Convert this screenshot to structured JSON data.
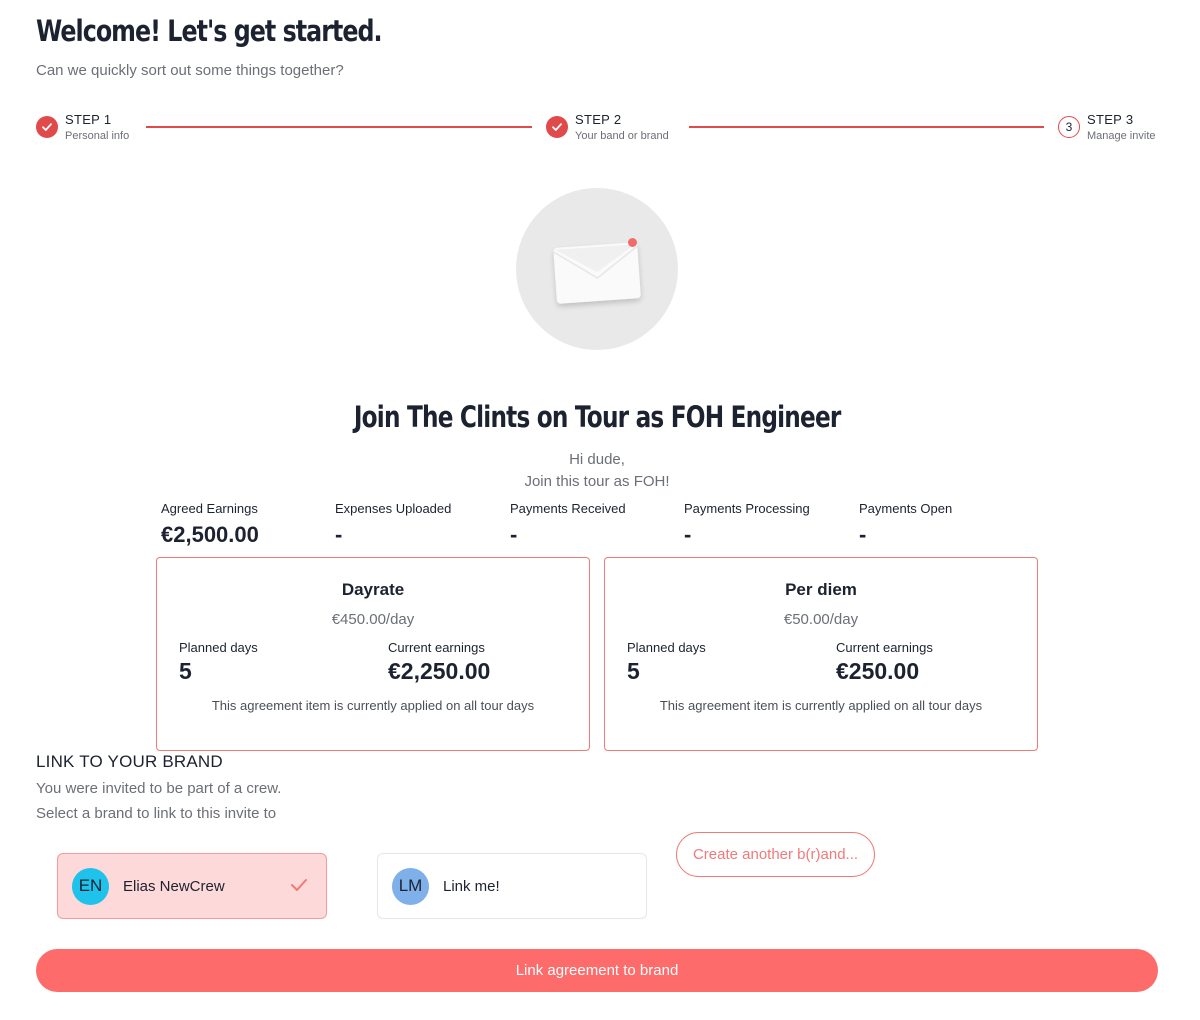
{
  "header": {
    "title": "Welcome! Let's get started.",
    "subtitle": "Can we quickly sort out some things together?"
  },
  "stepper": {
    "steps": [
      {
        "label": "STEP 1",
        "description": "Personal info",
        "status": "completed"
      },
      {
        "label": "STEP 2",
        "description": "Your band or brand",
        "status": "completed"
      },
      {
        "label": "STEP 3",
        "description": "Manage invite",
        "status": "current",
        "number": "3"
      }
    ]
  },
  "invite": {
    "icon": "envelope-icon",
    "title": "Join The Clints on Tour as FOH Engineer",
    "message_line1": "Hi dude,",
    "message_line2": "Join this tour as FOH!"
  },
  "stats": [
    {
      "label": "Agreed Earnings",
      "value": "€2,500.00"
    },
    {
      "label": "Expenses Uploaded",
      "value": "-"
    },
    {
      "label": "Payments Received",
      "value": "-"
    },
    {
      "label": "Payments Processing",
      "value": "-"
    },
    {
      "label": "Payments Open",
      "value": "-"
    }
  ],
  "agreement_items": [
    {
      "title": "Dayrate",
      "rate": "€450.00/day",
      "planned_days_label": "Planned days",
      "planned_days": "5",
      "earnings_label": "Current earnings",
      "earnings": "€2,250.00",
      "note": "This agreement item is currently applied on all tour days"
    },
    {
      "title": "Per diem",
      "rate": "€50.00/day",
      "planned_days_label": "Planned days",
      "planned_days": "5",
      "earnings_label": "Current earnings",
      "earnings": "€250.00",
      "note": "This agreement item is currently applied on all tour days"
    }
  ],
  "link_brand": {
    "title": "LINK TO YOUR BRAND",
    "text_line1": "You were invited to be part of a crew.",
    "text_line2": "Select a brand to link to this invite to",
    "brands": [
      {
        "initials": "EN",
        "name": "Elias NewCrew",
        "selected": true,
        "avatar_color": "#1fc2ea"
      },
      {
        "initials": "LM",
        "name": "Link me!",
        "selected": false,
        "avatar_color": "#7fb0ea"
      }
    ],
    "create_label": "Create another b(r)and...",
    "submit_label": "Link agreement to brand"
  },
  "colors": {
    "accent": "#e04a4a",
    "primary_button": "#fe6b6b",
    "selected_card_bg": "#fdd9d9",
    "card_border": "#f07a7a"
  }
}
